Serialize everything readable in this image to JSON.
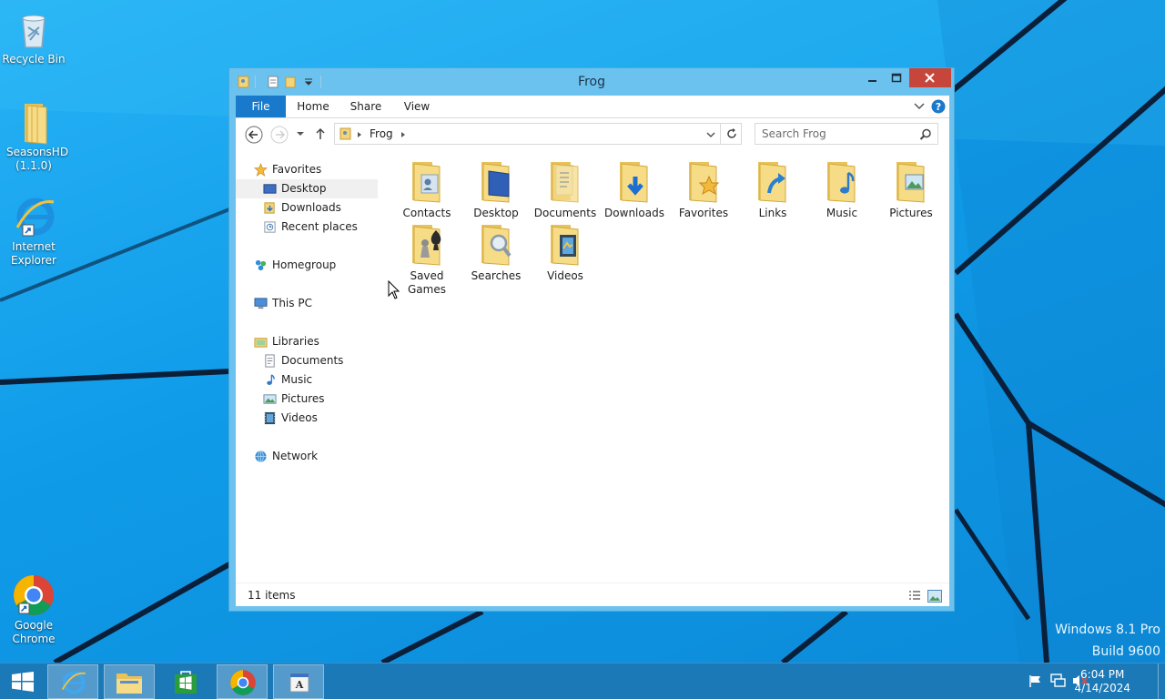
{
  "desktop": {
    "icons": [
      {
        "label": "Recycle Bin"
      },
      {
        "label": "SeasonsHD (1.1.0)"
      },
      {
        "label": "Internet Explorer"
      },
      {
        "label": "Google Chrome"
      }
    ],
    "watermark": {
      "line1": "Windows 8.1 Pro",
      "line2": "Build 9600"
    }
  },
  "window": {
    "title": "Frog",
    "ribbon_tabs": [
      "File",
      "Home",
      "Share",
      "View"
    ],
    "address": {
      "path_root_icon": "user-folder-icon",
      "segments": [
        "Frog"
      ]
    },
    "search": {
      "placeholder": "Search Frog"
    },
    "nav_pane": {
      "favorites": {
        "label": "Favorites",
        "items": [
          "Desktop",
          "Downloads",
          "Recent places"
        ],
        "selected": "Desktop"
      },
      "homegroup": "Homegroup",
      "this_pc": "This PC",
      "libraries": {
        "label": "Libraries",
        "items": [
          "Documents",
          "Music",
          "Pictures",
          "Videos"
        ]
      },
      "network": "Network"
    },
    "items": [
      {
        "label": "Contacts",
        "icon": "contacts-folder-icon"
      },
      {
        "label": "Desktop",
        "icon": "desktop-folder-icon"
      },
      {
        "label": "Documents",
        "icon": "documents-folder-icon"
      },
      {
        "label": "Downloads",
        "icon": "downloads-folder-icon"
      },
      {
        "label": "Favorites",
        "icon": "favorites-folder-icon"
      },
      {
        "label": "Links",
        "icon": "links-folder-icon"
      },
      {
        "label": "Music",
        "icon": "music-folder-icon"
      },
      {
        "label": "Pictures",
        "icon": "pictures-folder-icon"
      },
      {
        "label": "Saved Games",
        "icon": "saved-games-folder-icon"
      },
      {
        "label": "Searches",
        "icon": "searches-folder-icon"
      },
      {
        "label": "Videos",
        "icon": "videos-folder-icon"
      }
    ],
    "status": "11 items"
  },
  "taskbar": {
    "pinned": [
      "start-button",
      "internet-explorer",
      "file-explorer",
      "store",
      "google-chrome",
      "wordpad"
    ],
    "time": "6:04 PM",
    "date": "4/14/2024"
  },
  "colors": {
    "accent": "#1979ca",
    "titlebar": "#6cc2ee",
    "close": "#c7463c",
    "taskbar": "#1b79b8",
    "folder": "#f3d57a"
  }
}
